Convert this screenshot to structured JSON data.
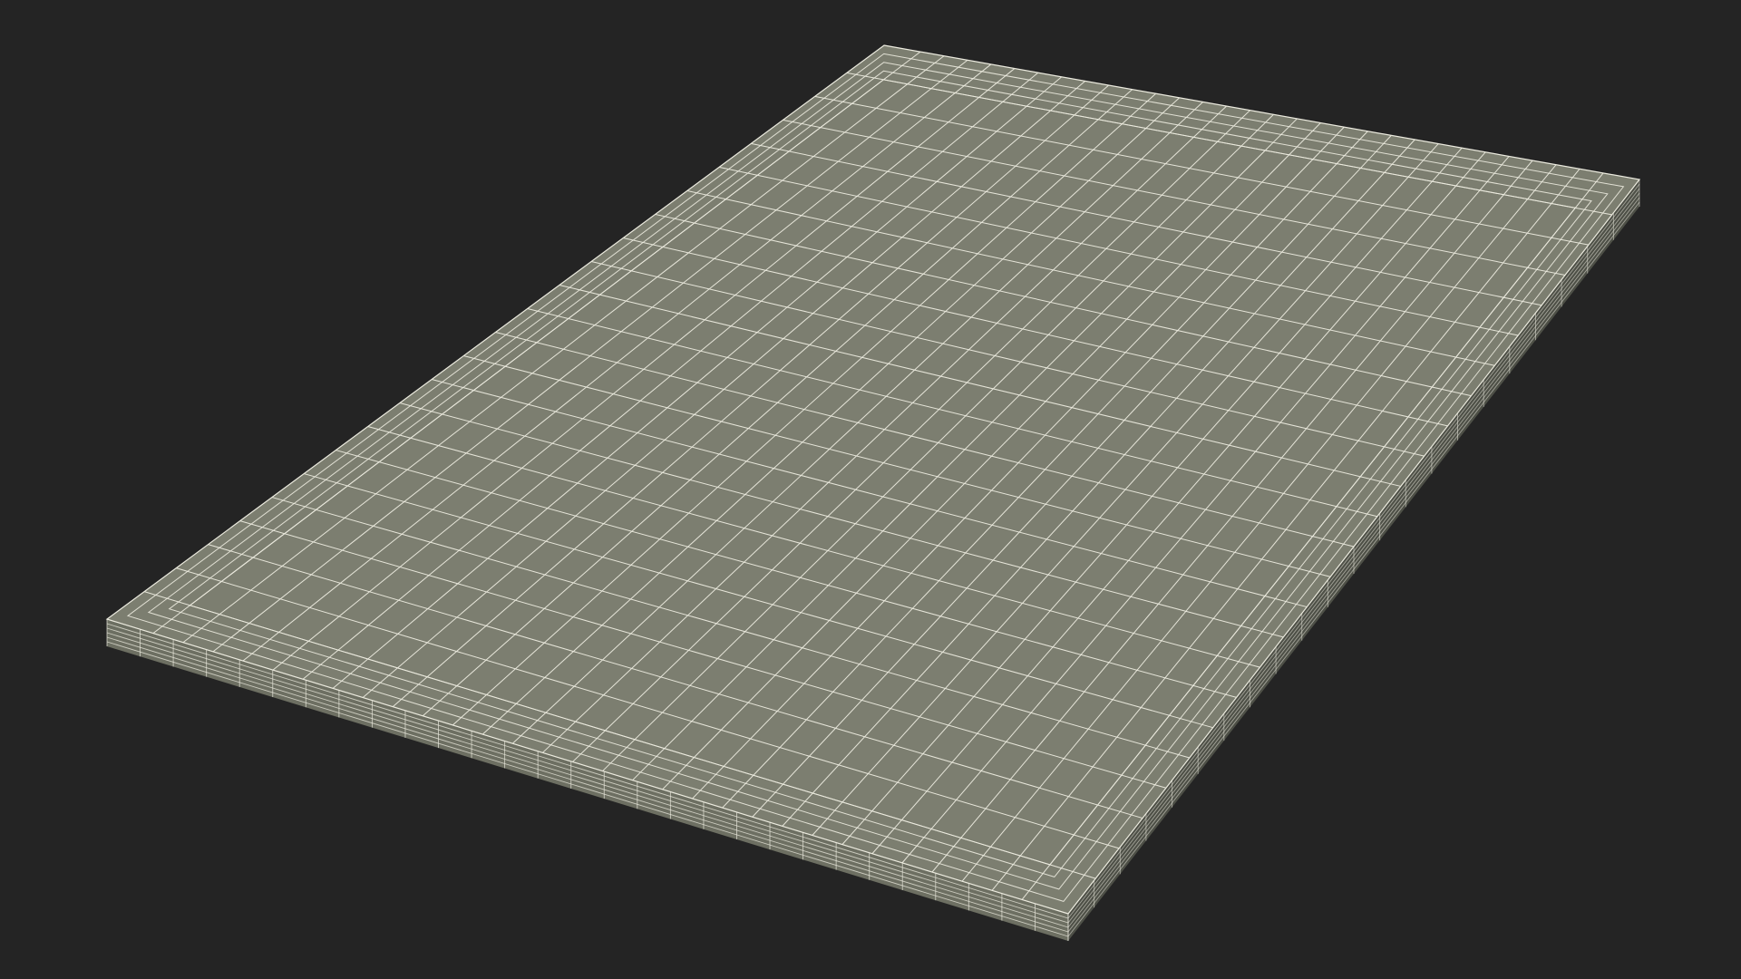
{
  "scene": {
    "subject": "wireframe-board",
    "colors": {
      "background": "#242424",
      "surface": "#7c7e70",
      "edge_side": "#6d6f62",
      "edge_shadow": "#4e5047",
      "wire": "#ecebdf"
    },
    "grid": {
      "columns": 29,
      "rows": 22
    }
  }
}
